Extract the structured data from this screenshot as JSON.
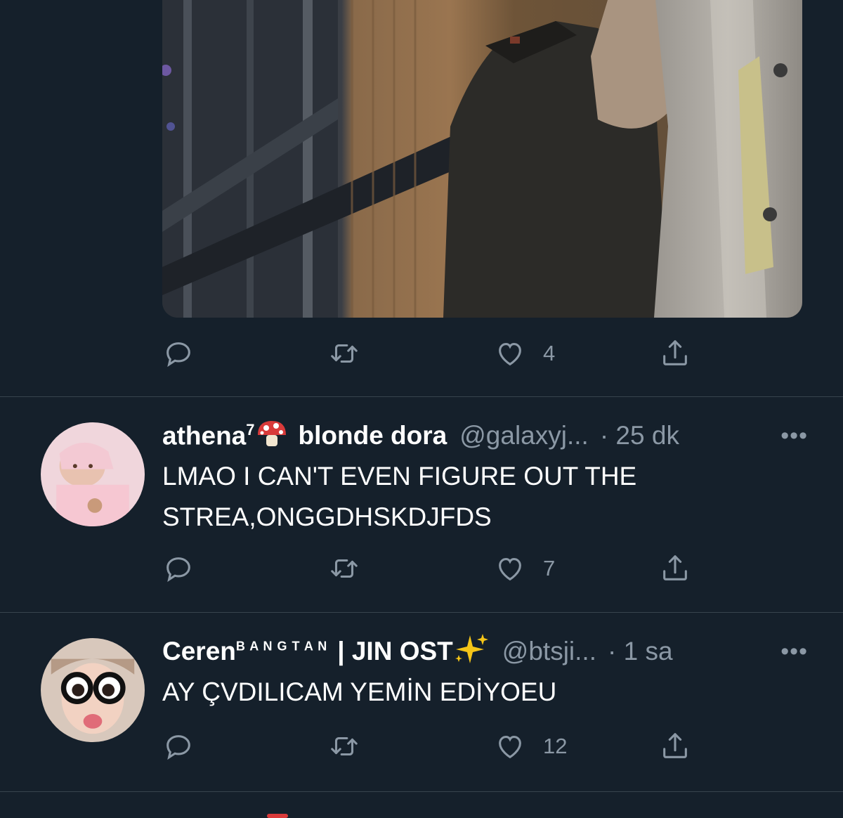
{
  "media_tweet": {
    "actions": {
      "reply_count": "",
      "retweet_count": "",
      "like_count": "4"
    }
  },
  "tweets": [
    {
      "display_name": "athena",
      "name_superscript": "7",
      "name_emoji": "mushroom",
      "name_suffix": "blonde dora",
      "handle": "@galaxyj...",
      "time": "· 25 dk",
      "text_line1": "LMAO I CAN'T EVEN FIGURE OUT THE",
      "text_line2": "STREA,ONGGDHSKDJFDS",
      "like_count": "7"
    },
    {
      "display_name": "Ceren",
      "name_superscript": "B A N G T A N",
      "name_suffix": "| JIN OST",
      "name_emoji": "sparkles",
      "handle": "@btsji...",
      "time": "· 1 sa",
      "text_line1": "AY ÇVDILICAM YEMİN EDİYOEU",
      "like_count": "12"
    }
  ],
  "more_label": "•••",
  "colors": {
    "background": "#15202b",
    "secondary_text": "#8b98a5",
    "divider": "#38444d"
  },
  "icons": [
    "reply-icon",
    "retweet-icon",
    "like-icon",
    "share-icon",
    "more-icon"
  ]
}
